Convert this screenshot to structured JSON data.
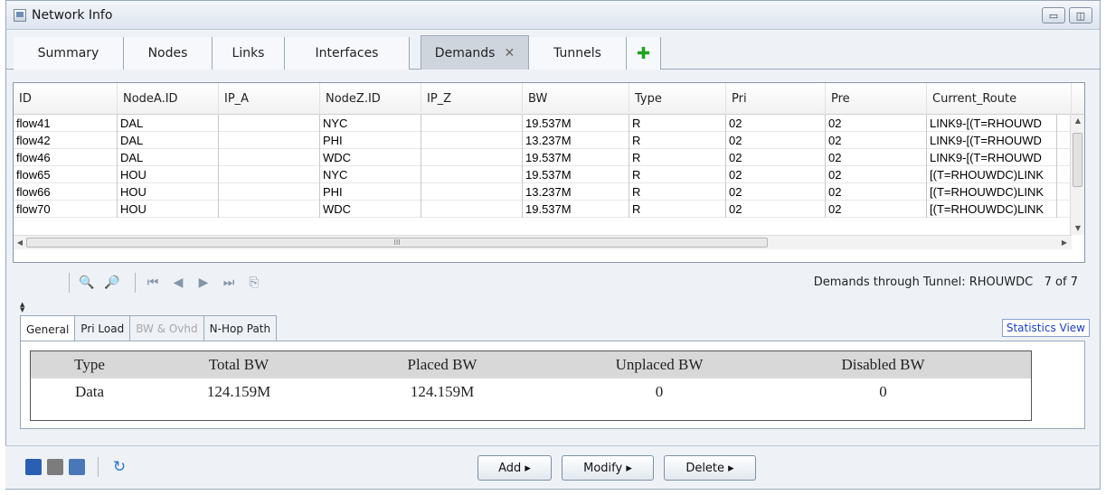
{
  "window": {
    "title": "Network Info"
  },
  "tabs": [
    {
      "label": "Summary"
    },
    {
      "label": "Nodes"
    },
    {
      "label": "Links"
    },
    {
      "label": "Interfaces"
    },
    {
      "label": "Demands",
      "active": true,
      "closable": true
    },
    {
      "label": "Tunnels"
    }
  ],
  "grid": {
    "columns": [
      "ID",
      "NodeA.ID",
      "IP_A",
      "NodeZ.ID",
      "IP_Z",
      "BW",
      "Type",
      "Pri",
      "Pre",
      "Current_Route"
    ],
    "rows": [
      [
        "flow41",
        "DAL",
        "",
        "NYC",
        "",
        "19.537M",
        "R",
        "02",
        "02",
        "LINK9-[(T=RHOUWD"
      ],
      [
        "flow42",
        "DAL",
        "",
        "PHI",
        "",
        "13.237M",
        "R",
        "02",
        "02",
        "LINK9-[(T=RHOUWD"
      ],
      [
        "flow46",
        "DAL",
        "",
        "WDC",
        "",
        "19.537M",
        "R",
        "02",
        "02",
        "LINK9-[(T=RHOUWD"
      ],
      [
        "flow65",
        "HOU",
        "",
        "NYC",
        "",
        "19.537M",
        "R",
        "02",
        "02",
        "[(T=RHOUWDC)LINK"
      ],
      [
        "flow66",
        "HOU",
        "",
        "PHI",
        "",
        "13.237M",
        "R",
        "02",
        "02",
        "[(T=RHOUWDC)LINK"
      ],
      [
        "flow70",
        "HOU",
        "",
        "WDC",
        "",
        "19.537M",
        "R",
        "02",
        "02",
        "[(T=RHOUWDC)LINK"
      ]
    ],
    "hscroll_grip": "III"
  },
  "status": {
    "text": "Demands through Tunnel: RHOUWDC",
    "count": "7 of 7"
  },
  "subtabs": [
    {
      "label": "General",
      "active": true
    },
    {
      "label": "Pri Load"
    },
    {
      "label": "BW & Ovhd",
      "disabled": true
    },
    {
      "label": "N-Hop Path"
    }
  ],
  "statistics_link": "Statistics View",
  "summary": {
    "headers": [
      "Type",
      "Total BW",
      "Placed BW",
      "Unplaced BW",
      "Disabled BW"
    ],
    "values": [
      "Data",
      "124.159M",
      "124.159M",
      "0",
      "0"
    ]
  },
  "actions": {
    "add": "Add ▸",
    "modify": "Modify ▸",
    "delete": "Delete ▸"
  },
  "icons": {
    "save": "save-icon",
    "print": "print-icon",
    "help": "help-icon",
    "refresh": "refresh-icon",
    "find": "find-icon",
    "find_next": "find-next-icon",
    "first": "first-page-icon",
    "prev": "prev-page-icon",
    "next": "next-page-icon",
    "last": "last-page-icon",
    "export": "export-icon"
  },
  "colors": {
    "plus": "#22a022",
    "link": "#1a3ec8",
    "summary_header": "#d8d8d8"
  }
}
